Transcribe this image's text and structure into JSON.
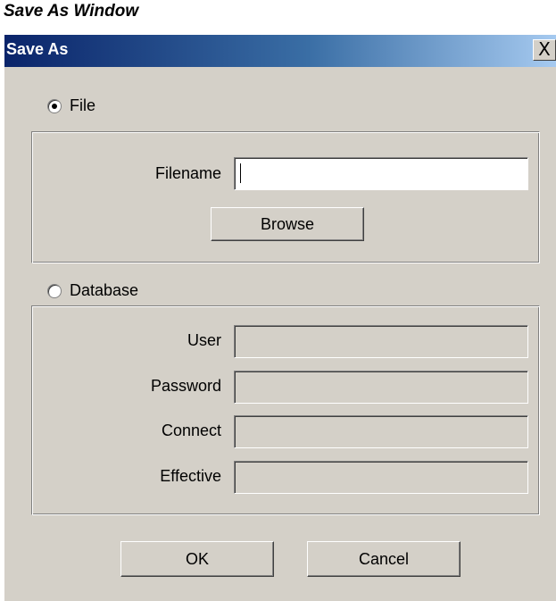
{
  "page": {
    "title": "Save As Window"
  },
  "dialog": {
    "title": "Save As",
    "close_label": "X"
  },
  "file_section": {
    "radio_label": "File",
    "selected": true,
    "filename_label": "Filename",
    "filename_value": "",
    "browse_label": "Browse"
  },
  "database_section": {
    "radio_label": "Database",
    "selected": false,
    "fields": [
      {
        "label": "User",
        "value": ""
      },
      {
        "label": "Password",
        "value": ""
      },
      {
        "label": "Connect",
        "value": ""
      },
      {
        "label": "Effective",
        "value": ""
      }
    ]
  },
  "buttons": {
    "ok_label": "OK",
    "cancel_label": "Cancel"
  },
  "colors": {
    "titlebar_start": "#0a246a",
    "titlebar_end": "#a6caf0",
    "dialog_bg": "#d4d0c8"
  }
}
